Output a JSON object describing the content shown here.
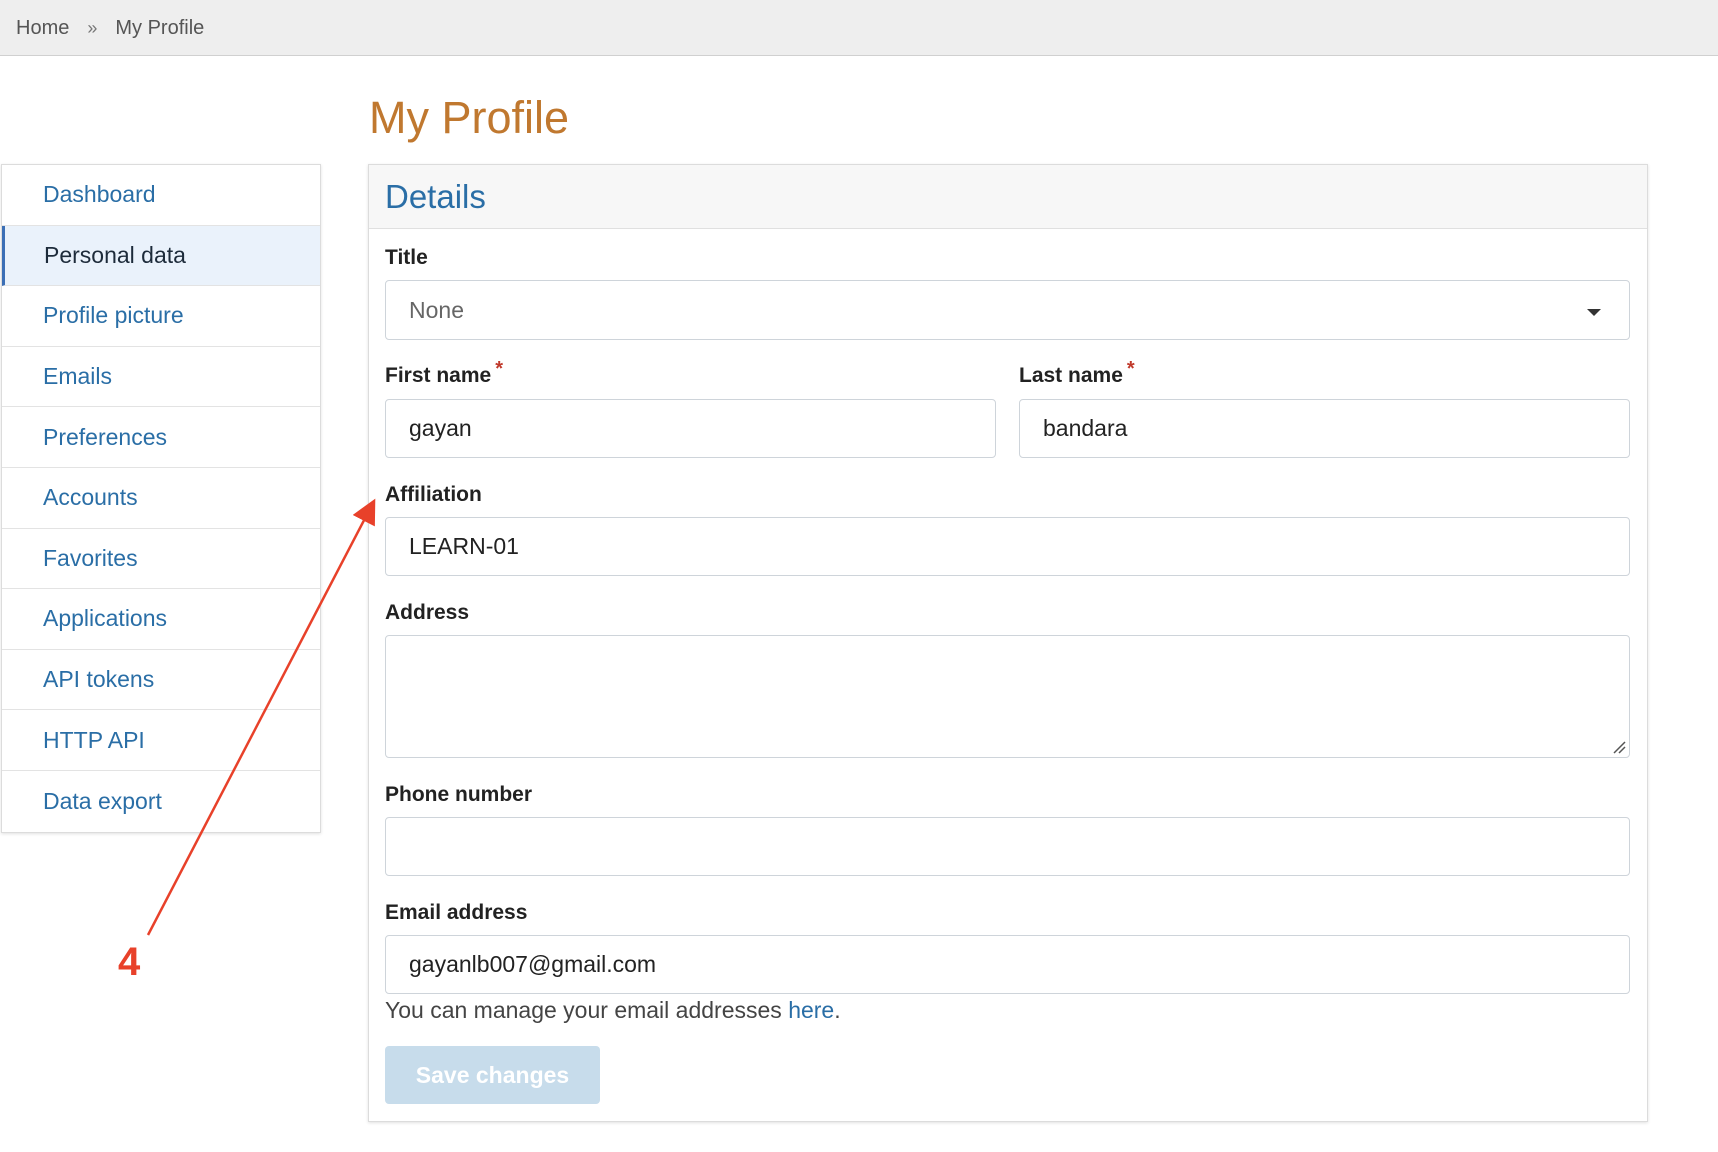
{
  "breadcrumb": {
    "home": "Home",
    "separator": "»",
    "current": "My Profile"
  },
  "page": {
    "title": "My Profile"
  },
  "sidebar": {
    "items": [
      {
        "label": "Dashboard"
      },
      {
        "label": "Personal data",
        "active": true
      },
      {
        "label": "Profile picture"
      },
      {
        "label": "Emails"
      },
      {
        "label": "Preferences"
      },
      {
        "label": "Accounts"
      },
      {
        "label": "Favorites"
      },
      {
        "label": "Applications"
      },
      {
        "label": "API tokens"
      },
      {
        "label": "HTTP API"
      },
      {
        "label": "Data export"
      }
    ]
  },
  "panel": {
    "header": "Details"
  },
  "form": {
    "title_label": "Title",
    "title_value": "None",
    "first_name_label": "First name",
    "first_name_value": "gayan",
    "last_name_label": "Last name",
    "last_name_value": "bandara",
    "required_marker": "*",
    "affiliation_label": "Affiliation",
    "affiliation_value": "LEARN-01",
    "address_label": "Address",
    "address_value": "",
    "phone_label": "Phone number",
    "phone_value": "",
    "email_label": "Email address",
    "email_value": "gayanlb007@gmail.com",
    "help_text": "You can manage your email addresses ",
    "help_link": "here",
    "help_suffix": ".",
    "save_label": "Save changes"
  },
  "annotation": {
    "number": "4",
    "color": "#e8412a"
  },
  "colors": {
    "accent": "#2a6ea6",
    "title": "#c0782f",
    "required": "#c0392b",
    "button_disabled": "#c7dceb"
  }
}
